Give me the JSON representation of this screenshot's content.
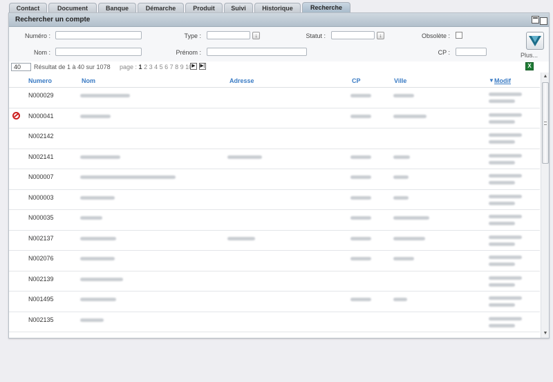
{
  "tabs": [
    {
      "label": "Contact",
      "active": false
    },
    {
      "label": "Document",
      "active": false
    },
    {
      "label": "Banque",
      "active": false
    },
    {
      "label": "Démarche",
      "active": false
    },
    {
      "label": "Produit",
      "active": false
    },
    {
      "label": "Suivi",
      "active": false
    },
    {
      "label": "Historique",
      "active": false
    },
    {
      "label": "Recherche",
      "active": true
    }
  ],
  "panel": {
    "title": "Rechercher un compte"
  },
  "form": {
    "numero_label": "Numéro :",
    "type_label": "Type :",
    "statut_label": "Statut :",
    "obsolete_label": "Obsolète :",
    "nom_label": "Nom :",
    "prenom_label": "Prénom :",
    "cp_label": "CP :",
    "numero_value": "",
    "type_value": "",
    "statut_value": "",
    "nom_value": "",
    "prenom_value": "",
    "cp_value": "",
    "obsolete_checked": false,
    "more_label": "Plus..."
  },
  "pager": {
    "page_size": "40",
    "result_text": "Résultat de 1 à 40 sur 1078",
    "page_label": "page :",
    "current_page": "1",
    "other_pages": "2 3 4 5 6 7 8 9 10"
  },
  "grid": {
    "columns": {
      "numero": "Numero",
      "nom": "Nom",
      "adresse": "Adresse",
      "cp": "CP",
      "ville": "Ville",
      "modif": "Modif"
    },
    "rows": [
      {
        "numero": "N000029",
        "flag": false
      },
      {
        "numero": "N000041",
        "flag": true
      },
      {
        "numero": "N002142",
        "flag": false
      },
      {
        "numero": "N002141",
        "flag": false
      },
      {
        "numero": "N000007",
        "flag": false
      },
      {
        "numero": "N000003",
        "flag": false
      },
      {
        "numero": "N000035",
        "flag": false
      },
      {
        "numero": "N002137",
        "flag": false
      },
      {
        "numero": "N002076",
        "flag": false
      },
      {
        "numero": "N002139",
        "flag": false
      },
      {
        "numero": "N001495",
        "flag": false
      },
      {
        "numero": "N002135",
        "flag": false
      }
    ]
  },
  "colors": {
    "accent": "#3a7bc4",
    "header": "#b2c0cc",
    "forbidden": "#cc1f1f"
  },
  "icons": {
    "page_next": "next-page-icon",
    "page_last": "last-page-icon",
    "export": "excel-icon",
    "validate": "check-v-icon",
    "forbidden": "forbidden-icon"
  }
}
